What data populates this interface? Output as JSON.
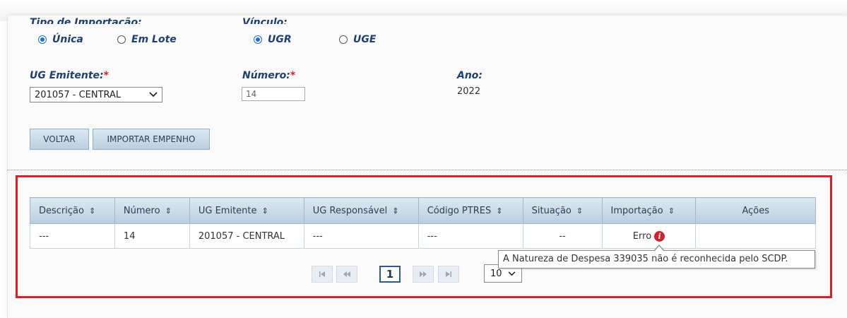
{
  "form": {
    "tipo_label": "Tipo de Importação:",
    "vinculo_label": "Vínculo:",
    "tipo_options": [
      "Única",
      "Em Lote"
    ],
    "tipo_selected": "Única",
    "vinculo_options": [
      "UGR",
      "UGE"
    ],
    "vinculo_selected": "UGR",
    "ug_emitente_label": "UG Emitente:",
    "ug_emitente_value": "201057 - CENTRAL",
    "numero_label": "Número:",
    "numero_value": "14",
    "ano_label": "Ano:",
    "ano_value": "2022",
    "required_mark": "*"
  },
  "buttons": {
    "voltar": "VOLTAR",
    "importar": "IMPORTAR EMPENHO"
  },
  "table": {
    "columns": [
      "Descrição",
      "Número",
      "UG Emitente",
      "UG Responsável",
      "Código PTRES",
      "Situação",
      "Importação",
      "Ações"
    ],
    "sort_icon": "⇕",
    "rows": [
      {
        "descricao": "---",
        "numero": "14",
        "ug_emitente": "201057 - CENTRAL",
        "ug_responsavel": "---",
        "codigo_ptres": "---",
        "situacao": "--",
        "importacao": "Erro",
        "acoes": ""
      }
    ]
  },
  "tooltip": {
    "text": "A Natureza de Despesa 339035 não é reconhecida pelo SCDP."
  },
  "pagination": {
    "first": "⏮",
    "prev": "⏪",
    "current_page": "1",
    "next": "⏩",
    "last": "⏭",
    "page_size": "10"
  },
  "colors": {
    "label_blue": "#1f3e72",
    "error_red": "#d3212b",
    "highlight_border": "#e21f26"
  },
  "icons": {
    "error": "error-info-icon",
    "dropdown": "chevron-down-icon",
    "sort": "sort-icon"
  }
}
